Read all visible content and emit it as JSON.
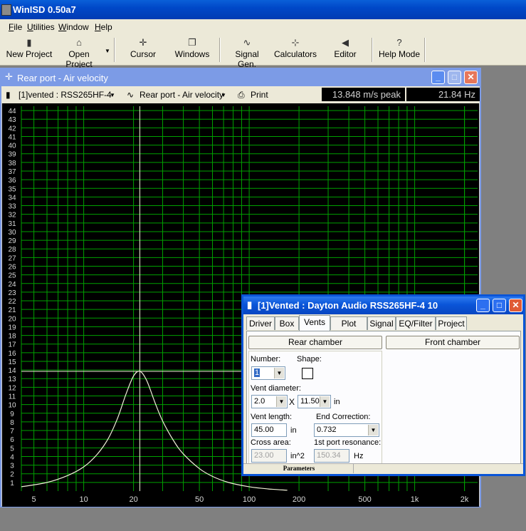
{
  "app": {
    "title": "WinISD 0.50a7"
  },
  "menu": [
    "File",
    "Utilities",
    "Window",
    "Help"
  ],
  "toolbar": {
    "new_project": "New Project",
    "open_project": "Open Project",
    "cursor": "Cursor",
    "windows": "Windows",
    "signal_gen": "Signal Gen.",
    "calculators": "Calculators",
    "editor": "Editor",
    "help_mode": "Help Mode"
  },
  "chart_window": {
    "title": "Rear port - Air velocity",
    "project_select": "[1]vented : RSS265HF-4",
    "graph_select": "Rear port - Air velocity",
    "print": "Print",
    "readout_value": "13.848 m/s peak",
    "readout_freq": "21.84 Hz"
  },
  "colors": {
    "grid": "#00a000",
    "curve": "#f0f0d8",
    "cursor": "#f0f0d8",
    "plot_bg": "#000000"
  },
  "chart_data": {
    "type": "line",
    "xscale": "log",
    "xlim": [
      4.2,
      2400
    ],
    "ylim": [
      0,
      44.5
    ],
    "xticks": [
      "5",
      "10",
      "20",
      "50",
      "100",
      "200",
      "500",
      "1k",
      "2k"
    ],
    "xtick_values": [
      5,
      10,
      20,
      50,
      100,
      200,
      500,
      1000,
      2000
    ],
    "yticks": [
      "1",
      "2",
      "3",
      "4",
      "5",
      "6",
      "7",
      "8",
      "9",
      "10",
      "11",
      "12",
      "13",
      "14",
      "15",
      "16",
      "17",
      "18",
      "19",
      "20",
      "21",
      "22",
      "23",
      "24",
      "25",
      "26",
      "27",
      "28",
      "29",
      "30",
      "31",
      "32",
      "33",
      "34",
      "35",
      "36",
      "37",
      "38",
      "39",
      "40",
      "41",
      "42",
      "43",
      "44"
    ],
    "cursor": {
      "x": 21.84,
      "y": 13.848
    },
    "series": [
      {
        "x": [
          4.2,
          6,
          8,
          10,
          12,
          14,
          16,
          18,
          20,
          21.84,
          24,
          27,
          30,
          35,
          40,
          50,
          60,
          75,
          100,
          130,
          170
        ],
        "y": [
          0.5,
          1.0,
          1.8,
          2.8,
          4.2,
          6.0,
          8.4,
          11.2,
          13.3,
          13.848,
          12.8,
          10.2,
          8.1,
          5.8,
          4.3,
          2.6,
          1.7,
          1.0,
          0.5,
          0.25,
          0.1
        ]
      }
    ]
  },
  "params_window": {
    "title": "[1]Vented : Dayton Audio RSS265HF-4 10",
    "tabs": [
      "Driver",
      "Box",
      "Vents",
      "Plot",
      "Signal",
      "EQ/Filter",
      "Project"
    ],
    "rear_chamber": "Rear chamber",
    "front_chamber": "Front chamber",
    "number_label": "Number:",
    "number_value": "1",
    "shape_label": "Shape:",
    "vent_diameter_label": "Vent diameter:",
    "vent_diameter_value": "2.0",
    "times": "X",
    "vent_diameter_value2": "11.50",
    "unit_in": "in",
    "vent_length_label": "Vent length:",
    "vent_length_value": "45.00",
    "end_correction_label": "End Correction:",
    "end_correction_value": "0.732",
    "cross_area_label": "Cross area:",
    "cross_area_value": "23.00",
    "cross_area_unit": "in^2",
    "resonance_label": "1st port resonance:",
    "resonance_value": "150.34",
    "resonance_unit": "Hz",
    "status": "Parameters"
  }
}
